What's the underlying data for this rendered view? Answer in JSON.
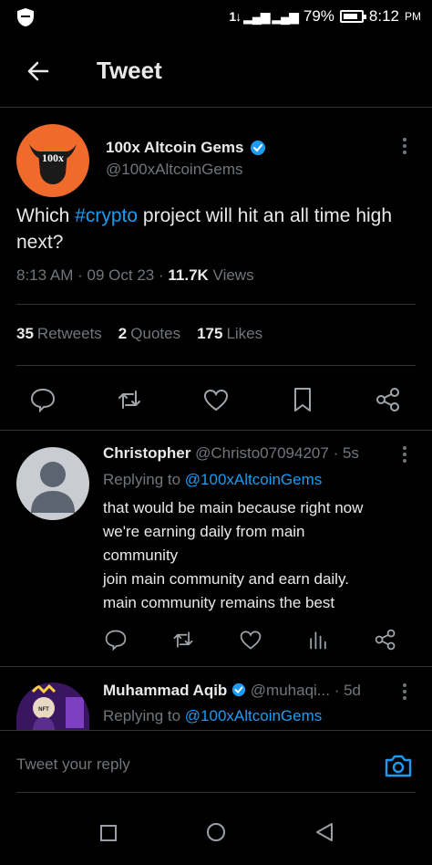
{
  "status_bar": {
    "signal_label": "1↓ ▂▄▆ ▂▄▆",
    "battery_percent": "79%",
    "time": "8:12",
    "ampm": "PM"
  },
  "header": {
    "title": "Tweet"
  },
  "tweet": {
    "author_name": "100x Altcoin Gems",
    "author_handle": "@100xAltcoinGems",
    "avatar_text": "100x",
    "text_before": "Which ",
    "hashtag": "#crypto",
    "text_after": " project will hit an all time high next?",
    "time": "8:13 AM",
    "date": "09 Oct 23",
    "views_count": "11.7K",
    "views_label": "Views",
    "sep": "·",
    "retweets_count": "35",
    "retweets_label": "Retweets",
    "quotes_count": "2",
    "quotes_label": "Quotes",
    "likes_count": "175",
    "likes_label": "Likes"
  },
  "replies": [
    {
      "name": "Christopher",
      "handle": "@Christo07094207",
      "age": "· 5s",
      "replying_prefix": "Replying to ",
      "replying_to": "@100xAltcoinGems",
      "lines": [
        "that would be main because right now",
        "we're earning daily from main",
        "community",
        "join main community and earn daily.",
        "main community remains the best"
      ]
    },
    {
      "name": "Muhammad Aqib",
      "handle": "@muhaqi...",
      "age": "· 5d",
      "replying_prefix": "Replying to ",
      "replying_to": "@100xAltcoinGems",
      "avatar_text": "NFT"
    }
  ],
  "composer": {
    "placeholder": "Tweet your reply"
  },
  "colors": {
    "accent": "#1d9bf0",
    "background": "#000000",
    "muted": "#71767b",
    "avatar_orange": "#f06a2b"
  }
}
